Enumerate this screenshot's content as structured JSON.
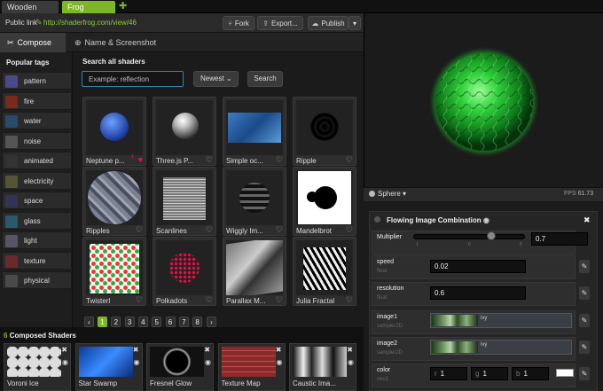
{
  "tabs": [
    {
      "label": "Wooden Bun"
    },
    {
      "label": "Frog Skin"
    }
  ],
  "link": {
    "label": "Public link",
    "url": "http://shaderfrog.com/view/46"
  },
  "toolbar": {
    "fork": "Fork",
    "export": "Export...",
    "publish": "Publish"
  },
  "compose_tabs": {
    "compose": "Compose",
    "name": "Name & Screenshot"
  },
  "sidebar": {
    "title": "Popular tags",
    "tags": [
      "pattern",
      "fire",
      "water",
      "noise",
      "animated",
      "electricity",
      "space",
      "glass",
      "light",
      "texture",
      "physical"
    ]
  },
  "search": {
    "title": "Search all shaders",
    "placeholder": "Example: reflection",
    "sort": "Newest",
    "button": "Search"
  },
  "shaders": [
    {
      "name": "Neptune p...",
      "liked": true,
      "likes": "1"
    },
    {
      "name": "Three.js P...",
      "liked": false,
      "likes": ""
    },
    {
      "name": "Simple oc...",
      "liked": false,
      "likes": ""
    },
    {
      "name": "Ripple",
      "liked": false,
      "likes": ""
    },
    {
      "name": "Ripples",
      "liked": false,
      "likes": ""
    },
    {
      "name": "Scanlines",
      "liked": false,
      "likes": ""
    },
    {
      "name": "Wiggly Im...",
      "liked": false,
      "likes": ""
    },
    {
      "name": "Mandelbrot",
      "liked": false,
      "likes": ""
    },
    {
      "name": "Twisterl",
      "liked": false,
      "likes": ""
    },
    {
      "name": "Polkadots",
      "liked": false,
      "likes": ""
    },
    {
      "name": "Parallax M...",
      "liked": false,
      "likes": ""
    },
    {
      "name": "Julia Fractal",
      "liked": false,
      "likes": ""
    }
  ],
  "pagination": {
    "prev": "‹",
    "pages": [
      "1",
      "2",
      "3",
      "4",
      "5",
      "6",
      "7",
      "8"
    ],
    "next": "›",
    "current": "1"
  },
  "composed": {
    "count": "6",
    "title": "Composed Shaders",
    "items": [
      "Voroni Ice",
      "Star Swamp",
      "Fresnel Glow",
      "Texture Map",
      "Caustic Ima..."
    ]
  },
  "preview": {
    "geometry": "Sphere",
    "fps_label": "FPS",
    "fps": "61.73"
  },
  "properties": {
    "title": "Flowing Image Combination",
    "multiplier": {
      "label": "Multiplier",
      "value": "0.7",
      "ticks": [
        "1",
        "0",
        "5"
      ],
      "fraction": 0.7
    },
    "speed": {
      "label": "speed",
      "type": "float",
      "value": "0.02"
    },
    "resolution": {
      "label": "resolution",
      "type": "float",
      "value": "0.6"
    },
    "image1": {
      "label": "image1",
      "type": "sampler2D",
      "name": "ivy"
    },
    "image2": {
      "label": "image2",
      "type": "sampler2D",
      "name": "ivy"
    },
    "color": {
      "label": "color",
      "type": "vec3",
      "r_label": "r",
      "r": "1",
      "g_label": "g",
      "g": "1",
      "b_label": "b",
      "b": "1"
    }
  }
}
